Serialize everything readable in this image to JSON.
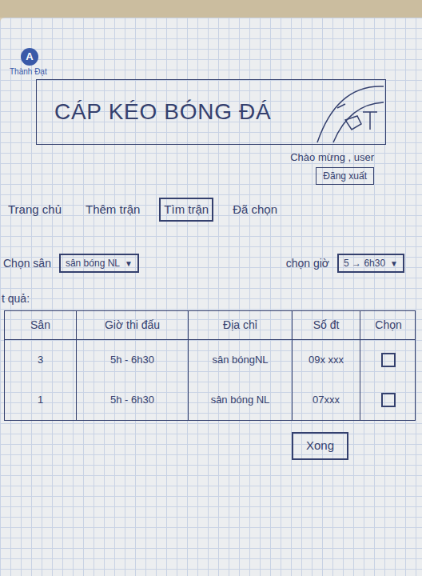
{
  "logo": {
    "letter": "A",
    "name": "Thành Đạt"
  },
  "title": "CÁP KÉO BÓNG ĐÁ",
  "user": {
    "greeting": "Chào mừng , user",
    "logout": "Đăng xuất"
  },
  "nav": [
    {
      "label": "Trang chủ",
      "selected": false
    },
    {
      "label": "Thêm trận",
      "selected": false
    },
    {
      "label": "Tìm trận",
      "selected": true
    },
    {
      "label": "Đã chọn",
      "selected": false
    }
  ],
  "filters": [
    {
      "label": "Chọn sân",
      "value": "sân bóng NL",
      "arrow": "▼"
    },
    {
      "label": "chọn giờ",
      "value": "5 → 6h30",
      "arrow": "▼"
    }
  ],
  "results_label": "t quả:",
  "table": {
    "columns": [
      "Sân",
      "Giờ thi đấu",
      "Địa chỉ",
      "Số đt",
      "Chọn"
    ],
    "rows": [
      {
        "cells": [
          "3",
          "5h - 6h30",
          "sân bóngNL",
          "09x xxx"
        ],
        "checked": false
      },
      {
        "cells": [
          "1",
          "5h - 6h30",
          "sân bóng NL",
          "07xxx"
        ],
        "checked": false
      }
    ]
  },
  "submit": "Xong"
}
